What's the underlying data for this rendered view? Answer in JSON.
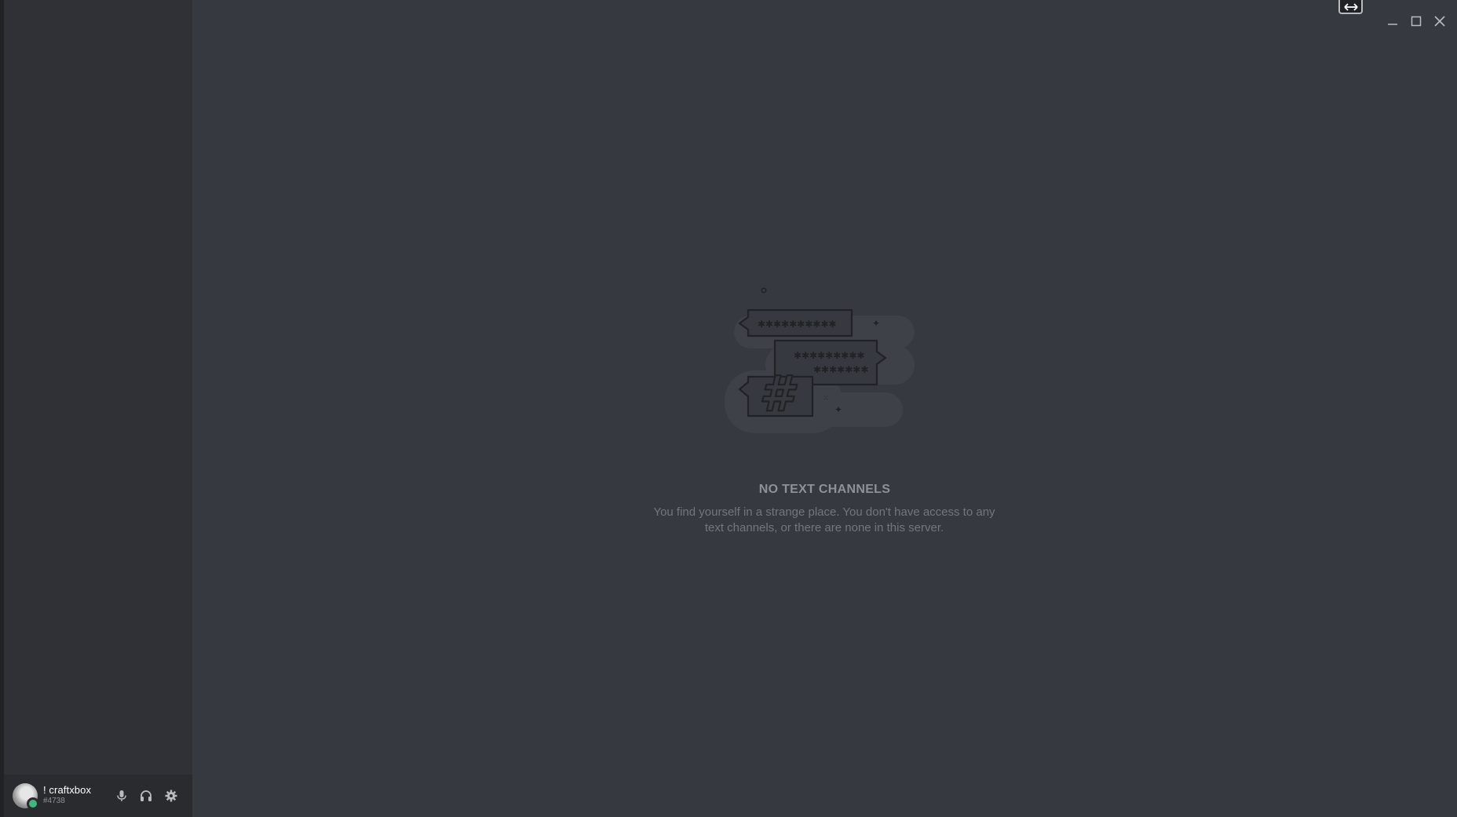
{
  "user": {
    "username": "! craftxbox",
    "discriminator": "#4738",
    "status_color": "#43b581"
  },
  "user_controls": {
    "mic_icon": "microphone-icon",
    "headphones_icon": "headphones-icon",
    "settings_icon": "gear-icon"
  },
  "window_controls": {
    "minimize_icon": "minimize-icon",
    "maximize_icon": "maximize-icon",
    "close_icon": "close-icon",
    "resize_icon": "horizontal-arrows-icon"
  },
  "empty_state": {
    "title": "NO TEXT CHANNELS",
    "description": "You find yourself in a strange place. You don't have access to any text channels, or there are none in this server."
  },
  "colors": {
    "background": "#36393f",
    "sidebar": "#2f3136",
    "user_panel": "#292b2f",
    "accent_green": "#43b581"
  }
}
